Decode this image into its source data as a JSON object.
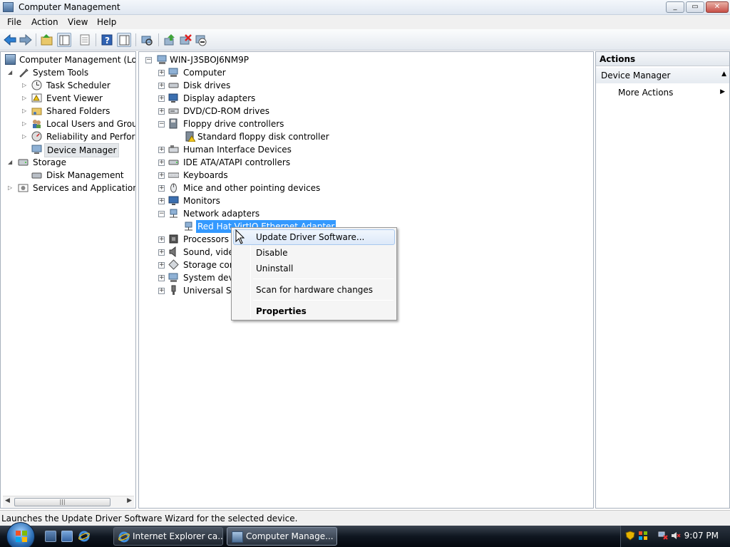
{
  "window": {
    "title": "Computer Management",
    "controls": [
      "minimize",
      "maximize",
      "close"
    ]
  },
  "menubar": {
    "items": [
      "File",
      "Action",
      "View",
      "Help"
    ]
  },
  "toolbar": {
    "icons": [
      "back-icon",
      "forward-icon",
      "up-folder-icon",
      "show-hide-tree-icon",
      "properties-icon",
      "help-icon",
      "show-hide-action-pane-icon",
      "scan-hardware-icon",
      "update-driver-icon",
      "uninstall-icon",
      "disable-icon"
    ]
  },
  "left_tree": {
    "root": "Computer Management (Local)",
    "items": [
      {
        "label": "System Tools",
        "level": 1,
        "expanded": true
      },
      {
        "label": "Task Scheduler",
        "level": 2
      },
      {
        "label": "Event Viewer",
        "level": 2
      },
      {
        "label": "Shared Folders",
        "level": 2
      },
      {
        "label": "Local Users and Groups",
        "level": 2
      },
      {
        "label": "Reliability and Performance",
        "level": 2
      },
      {
        "label": "Device Manager",
        "level": 2,
        "selected": true
      },
      {
        "label": "Storage",
        "level": 1,
        "expanded": true
      },
      {
        "label": "Disk Management",
        "level": 2
      },
      {
        "label": "Services and Applications",
        "level": 1
      }
    ]
  },
  "device_tree": {
    "root": "WIN-J3SBOJ6NM9P",
    "items": [
      {
        "label": "Computer",
        "child": false
      },
      {
        "label": "Disk drives",
        "child": false
      },
      {
        "label": "Display adapters",
        "child": false
      },
      {
        "label": "DVD/CD-ROM drives",
        "child": false
      },
      {
        "label": "Floppy drive controllers",
        "child": false,
        "expanded": true
      },
      {
        "label": "Standard floppy disk controller",
        "child": true
      },
      {
        "label": "Human Interface Devices",
        "child": false
      },
      {
        "label": "IDE ATA/ATAPI controllers",
        "child": false
      },
      {
        "label": "Keyboards",
        "child": false
      },
      {
        "label": "Mice and other pointing devices",
        "child": false
      },
      {
        "label": "Monitors",
        "child": false
      },
      {
        "label": "Network adapters",
        "child": false,
        "expanded": true
      },
      {
        "label": "Red Hat VirtIO Ethernet Adapter",
        "child": true,
        "highlighted": true
      },
      {
        "label": "Processors",
        "child": false
      },
      {
        "label": "Sound, video and game controllers",
        "child": false
      },
      {
        "label": "Storage controllers",
        "child": false
      },
      {
        "label": "System devices",
        "child": false
      },
      {
        "label": "Universal Serial Bus controllers",
        "child": false
      }
    ]
  },
  "context_menu": {
    "items": [
      {
        "label": "Update Driver Software...",
        "hover": true
      },
      {
        "label": "Disable"
      },
      {
        "label": "Uninstall"
      },
      {
        "label": "Scan for hardware changes"
      },
      {
        "label": "Properties",
        "bold": true
      }
    ]
  },
  "actions_pane": {
    "header": "Actions",
    "group": "Device Manager",
    "items": [
      "More Actions"
    ]
  },
  "statusbar": {
    "text": "Launches the Update Driver Software Wizard for the selected device."
  },
  "taskbar": {
    "buttons": [
      {
        "label": "Internet Explorer ca...",
        "active": false
      },
      {
        "label": "Computer Manage...",
        "active": true
      }
    ],
    "clock": "9:07 PM"
  },
  "colors": {
    "selection": "#3399ff",
    "titlebar": "#dfe7f1",
    "taskbar": "#0f1620"
  }
}
